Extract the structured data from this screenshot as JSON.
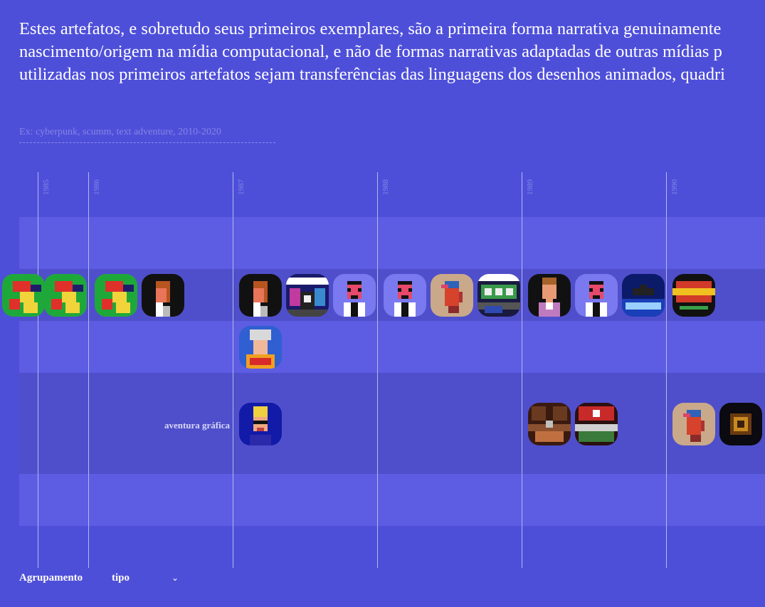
{
  "intro": {
    "line1": "Estes artefatos, e sobretudo seus primeiros exemplares, são a primeira forma narrativa genuinamente",
    "line2": "nascimento/origem na mídia computacional, e não de formas narrativas adaptadas de outras mídias p",
    "line3": "utilizadas nos primeiros artefatos sejam transferências das linguagens dos desenhos animados, quadri"
  },
  "search": {
    "placeholder": "Ex: cyberpunk, scumm, text adventure, 2010-2020",
    "value": ""
  },
  "timeline": {
    "years": [
      "1985",
      "1986",
      "1987",
      "1988",
      "1989",
      "1990"
    ],
    "rows": [
      {
        "label": "",
        "items": []
      },
      {
        "label": "",
        "items": [
          "green-knight-icon",
          "green-knight-icon",
          "green-knight-icon",
          "redhead-portrait-icon",
          "redhead-portrait-icon",
          "police-quest-cover-icon",
          "suited-man-icon",
          "suited-man-icon",
          "pixel-face-icon",
          "police-quest-2-cover-icon",
          "brown-hair-hero-icon",
          "suited-man-icon",
          "codename-iceman-cover-icon",
          "conquests-of-camelot-cover-icon"
        ]
      },
      {
        "label": "",
        "items": [
          "helmeted-warrior-icon"
        ]
      },
      {
        "label": "aventura gráfica",
        "items": [
          "blond-hero-icon",
          "office-scene-icon",
          "nazi-banner-scene-icon",
          "pixel-face-icon",
          "dark-orb-icon"
        ]
      },
      {
        "label": "",
        "items": []
      }
    ]
  },
  "controls": {
    "grouping_label": "Agrupamento",
    "grouping_value": "tipo",
    "grouping_options": [
      "tipo"
    ]
  },
  "colors": {
    "background": "#4e4fd9",
    "band_light": "#5c5de3",
    "band_dark": "#4f4fcb",
    "year_line": "#b6b7f2"
  }
}
